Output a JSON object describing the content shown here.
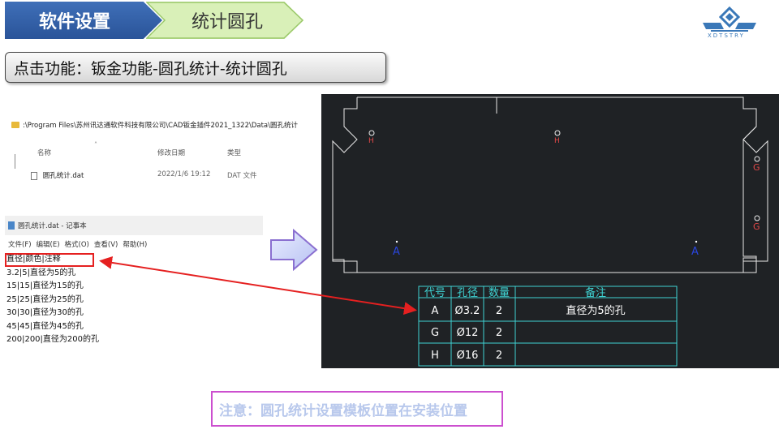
{
  "header": {
    "step1": "软件设置",
    "step2": "统计圆孔"
  },
  "instruction": "点击功能：钣金功能-圆孔统计-统计圆孔",
  "explorer": {
    "path": ":\\Program Files\\苏州讯达通软件科技有限公司\\CAD钣金插件2021_1322\\Data\\圆孔统计",
    "col_name": "名称",
    "col_modified": "修改日期",
    "col_type": "类型",
    "file_name": "圆孔统计.dat",
    "file_modified": "2022/1/6 19:12",
    "file_type": "DAT 文件"
  },
  "notepad": {
    "title": "圆孔统计.dat - 记事本",
    "menu": [
      "文件(F)",
      "编辑(E)",
      "格式(O)",
      "查看(V)",
      "帮助(H)"
    ],
    "lines": [
      "直径|颜色|注释",
      "3.2|5|直径为5的孔",
      "15|15|直径为15的孔",
      "25|25|直径为25的孔",
      "30|30|直径为30的孔",
      "45|45|直径为45的孔",
      "200|200|直径为200的孔"
    ]
  },
  "cad": {
    "labels": {
      "h": "H",
      "g": "G",
      "a": "A"
    },
    "table": {
      "headers": [
        "代号",
        "孔径",
        "数量",
        "备注"
      ],
      "rows": [
        [
          "A",
          "Ø3.2",
          "2",
          "直径为5的孔"
        ],
        [
          "G",
          "Ø12",
          "2",
          ""
        ],
        [
          "H",
          "Ø16",
          "2",
          ""
        ]
      ]
    }
  },
  "note": "注意：圆孔统计设置模板位置在安装位置",
  "logo_text": "XDTSTRY",
  "colors": {
    "accent_blue": "#2a5499",
    "light_green": "#d9f0b8",
    "red": "#e52020",
    "cad_bg": "#1f2225",
    "cad_cyan": "#3fd3d3",
    "note_border": "#cc4fcf"
  }
}
